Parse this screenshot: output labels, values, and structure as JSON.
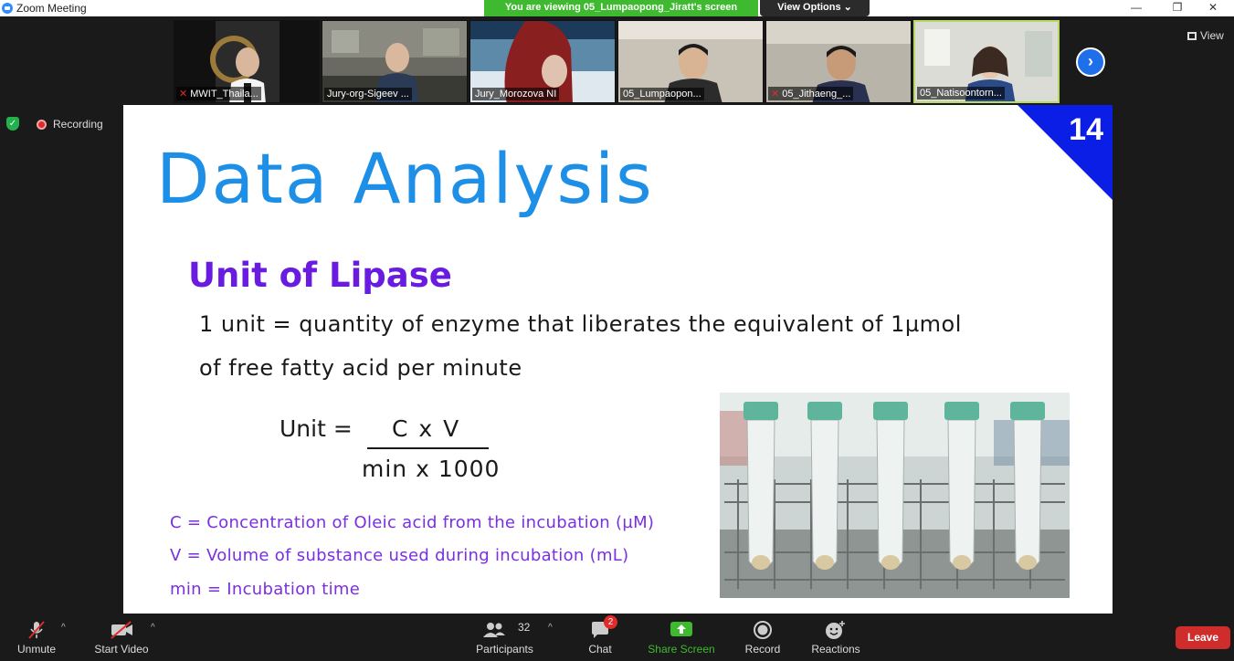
{
  "window": {
    "title": "Zoom Meeting",
    "viewing_banner": "You are viewing 05_Lumpaopong_Jiratt's screen",
    "view_options": "View Options ⌄",
    "minimize": "—",
    "restore": "❐",
    "close": "✕"
  },
  "participants_strip": [
    {
      "name": "MWIT_Thaila...",
      "muted": true
    },
    {
      "name": "Jury-org-Sigeev ...",
      "muted": false
    },
    {
      "name": "Jury_Morozova NI",
      "muted": false
    },
    {
      "name": "05_Lumpaopon...",
      "muted": false
    },
    {
      "name": "05_Jithaeng_...",
      "muted": true
    },
    {
      "name": "05_Natisoontorn...",
      "muted": false
    }
  ],
  "view_button": "View",
  "next_icon": "›",
  "recording_label": "Recording",
  "shield_icon": "✓",
  "slide": {
    "number": "14",
    "title": "Data Analysis",
    "subtitle": "Unit of Lipase",
    "definition_line1": "1 unit = quantity of enzyme that liberates the equivalent of 1µmol",
    "definition_line2": "of free fatty acid per minute",
    "formula_lhs": "Unit =",
    "formula_numerator": "C x V",
    "formula_denominator": "min x 1000",
    "legend": [
      "C = Concentration of Oleic acid from the incubation (µM)",
      "V = Volume of substance used during incubation (mL)",
      "min = Incubation time"
    ]
  },
  "toolbar": {
    "unmute": "Unmute",
    "start_video": "Start Video",
    "participants": "Participants",
    "participants_count": "32",
    "chat": "Chat",
    "chat_badge": "2",
    "share_screen": "Share Screen",
    "record": "Record",
    "reactions": "Reactions",
    "leave": "Leave",
    "caret": "^"
  },
  "colors": {
    "share_green": "#3fba30",
    "leave_red": "#cf2c2c",
    "slide_title_blue": "#1e8fe6",
    "slide_purple": "#6a1be0",
    "corner_blue": "#0a1ee6"
  }
}
